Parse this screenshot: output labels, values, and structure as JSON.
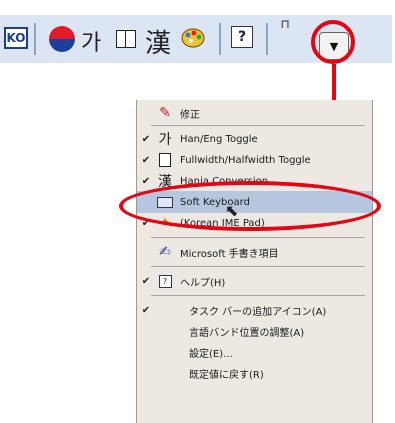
{
  "toolbar": {
    "ko_label": "KO",
    "hangul_glyph": "가",
    "hanja_glyph": "漢",
    "help_glyph": "?",
    "grip_glyph": "⊓",
    "options_arrow": "▼"
  },
  "menu": {
    "items": [
      {
        "label": "修正",
        "checked": false,
        "icon": "correction-icon"
      },
      {
        "label": "Han/Eng Toggle",
        "checked": true,
        "icon": "hangul-icon"
      },
      {
        "label": "Fullwidth/Halfwidth Toggle",
        "checked": true,
        "icon": "fullwidth-icon"
      },
      {
        "label": "Hanja Conversion",
        "checked": true,
        "icon": "hanja-icon"
      },
      {
        "label": "Soft Keyboard",
        "checked": false,
        "icon": "soft-keyboard-icon",
        "selected": true
      },
      {
        "label": "(Korean IME Pad)",
        "checked": true,
        "icon": "ime-pad-icon"
      },
      {
        "label": "Microsoft 手書き項目",
        "checked": false,
        "icon": "handwriting-icon"
      },
      {
        "label": "ヘルプ(H)",
        "checked": true,
        "icon": "help-icon"
      },
      {
        "label": "タスク バーの追加アイコン(A)",
        "checked": true,
        "icon": ""
      },
      {
        "label": "言語バンド位置の調整(A)",
        "checked": false,
        "icon": ""
      },
      {
        "label": "設定(E)...",
        "checked": false,
        "icon": ""
      },
      {
        "label": "既定値に戻す(R)",
        "checked": false,
        "icon": ""
      }
    ],
    "check_glyph": "✔"
  },
  "colors": {
    "callout_red": "#e30613",
    "toolbar_bg": "#dbe5f3",
    "menu_bg": "#ede9e2",
    "selection_bg": "#b7c6df"
  }
}
